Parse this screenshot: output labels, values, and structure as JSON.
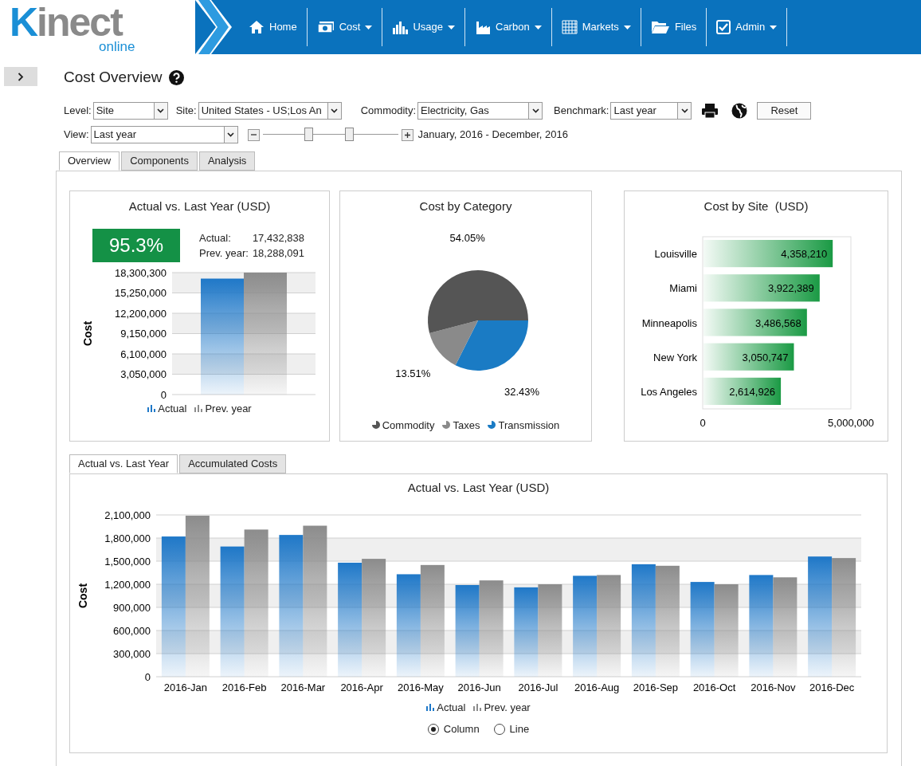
{
  "header": {
    "logo": "Kinect",
    "logo_sub": "online",
    "nav": [
      {
        "label": "Home",
        "dropdown": false
      },
      {
        "label": "Cost",
        "dropdown": true
      },
      {
        "label": "Usage",
        "dropdown": true
      },
      {
        "label": "Carbon",
        "dropdown": true
      },
      {
        "label": "Markets",
        "dropdown": true
      },
      {
        "label": "Files",
        "dropdown": false
      },
      {
        "label": "Admin",
        "dropdown": true
      }
    ]
  },
  "page_title": "Cost Overview",
  "filters": [
    {
      "label": "Level:",
      "value": "Site"
    },
    {
      "label": "Site:",
      "value": "United States - US;Los An"
    },
    {
      "label": "Commodity:",
      "value": "Electricity, Gas"
    },
    {
      "label": "Benchmark:",
      "value": "Last year"
    }
  ],
  "reset_button": "Reset",
  "view": {
    "label": "View:",
    "value": "Last year"
  },
  "range_slider": {
    "thumbs": [
      {
        "level": 0.34
      },
      {
        "level": 0.64
      }
    ],
    "text": "January, 2016 - December, 2016"
  },
  "tabs": [
    {
      "label": "Overview",
      "selected": true
    },
    {
      "label": "Components",
      "selected": false
    },
    {
      "label": "Analysis",
      "selected": false
    }
  ],
  "cards": [
    {
      "kpi": {
        "value": "95.3%",
        "rows": [
          {
            "label": "Actual:",
            "value": "17,432,838"
          },
          {
            "label": "Prev. year:",
            "value": "18,288,091"
          }
        ]
      },
      "chart_data": {
        "type": "bar",
        "title": "Actual vs. Last Year (USD)",
        "ylabel": "Cost",
        "ylim": [
          0,
          18300300
        ],
        "grid": true,
        "legend": "bottom",
        "yticks": [
          {
            "value": 0,
            "label": "0"
          },
          {
            "value": 3050000,
            "label": "3,050,000"
          },
          {
            "value": 6100000,
            "label": "6,100,000"
          },
          {
            "value": 9150000,
            "label": "9,150,000"
          },
          {
            "value": 12200000,
            "label": "12,200,000"
          },
          {
            "value": 15250000,
            "label": "15,250,000"
          },
          {
            "value": 18300300,
            "label": "18,300,300"
          }
        ],
        "series": [
          {
            "name": "Actual",
            "color": "#1f78c8",
            "values": [
              17400000
            ]
          },
          {
            "name": "Prev. year",
            "color": "#8c8c8c",
            "values": [
              18300000
            ]
          }
        ]
      }
    },
    {
      "chart_data": {
        "type": "pie",
        "title": "Cost by Category",
        "categories": [
          "Commodity",
          "Taxes",
          "Transmission"
        ],
        "legend": "bottom",
        "values": [
          54.05,
          13.51,
          32.43
        ],
        "colors": [
          "#555555",
          "#8a8a8a",
          "#1a7bc4"
        ],
        "value_labels": [
          "54.05%",
          "13.51%",
          "32.43%"
        ]
      }
    },
    {
      "chart_data": {
        "type": "bar",
        "orientation": "horizontal",
        "title": "Cost by Site  (USD)",
        "categories": [
          "Louisville",
          "Miami",
          "Minneapolis",
          "New York",
          "Los Angeles"
        ],
        "series": [
          {
            "color": "#1a9a44",
            "values": [
              4360000,
              3920000,
              3490000,
              3050000,
              2610000
            ]
          }
        ],
        "value_labels": [
          "4,358,210",
          "3,922,389",
          "3,486,568",
          "3,050,747",
          "2,614,926"
        ],
        "xlim": [
          0,
          5000000
        ],
        "xticks": [
          {
            "value": 0,
            "label": "0"
          },
          {
            "value": 5000000,
            "label": "5,000,000"
          }
        ]
      }
    }
  ],
  "lower_tabs": [
    {
      "label": "Actual vs. Last Year",
      "selected": true
    },
    {
      "label": "Accumulated Costs",
      "selected": false
    }
  ],
  "monthly_chart": {
    "chart_data": {
      "type": "bar",
      "title": "Actual vs. Last Year (USD)",
      "ylabel": "Cost",
      "ylim": [
        0,
        2100000
      ],
      "grid": true,
      "legend": "bottom",
      "categories": [
        "2016-Jan",
        "2016-Feb",
        "2016-Mar",
        "2016-Apr",
        "2016-May",
        "2016-Jun",
        "2016-Jul",
        "2016-Aug",
        "2016-Sep",
        "2016-Oct",
        "2016-Nov",
        "2016-Dec"
      ],
      "yticks": [
        {
          "value": 0,
          "label": "0"
        },
        {
          "value": 300000,
          "label": "300,000"
        },
        {
          "value": 600000,
          "label": "600,000"
        },
        {
          "value": 900000,
          "label": "900,000"
        },
        {
          "value": 1200000,
          "label": "1,200,000"
        },
        {
          "value": 1500000,
          "label": "1,500,000"
        },
        {
          "value": 1800000,
          "label": "1,800,000"
        },
        {
          "value": 2100000,
          "label": "2,100,000"
        }
      ],
      "series": [
        {
          "name": "Actual",
          "color": "#1f78c8",
          "values": [
            1820000,
            1690000,
            1840000,
            1480000,
            1330000,
            1190000,
            1160000,
            1310000,
            1460000,
            1230000,
            1320000,
            1560000
          ]
        },
        {
          "name": "Prev. year",
          "color": "#8c8c8c",
          "values": [
            2090000,
            1910000,
            1960000,
            1530000,
            1450000,
            1250000,
            1200000,
            1320000,
            1440000,
            1200000,
            1290000,
            1540000
          ]
        }
      ]
    },
    "chart_type": [
      {
        "label": "Column",
        "selected": true
      },
      {
        "label": "Line",
        "selected": false
      }
    ]
  }
}
